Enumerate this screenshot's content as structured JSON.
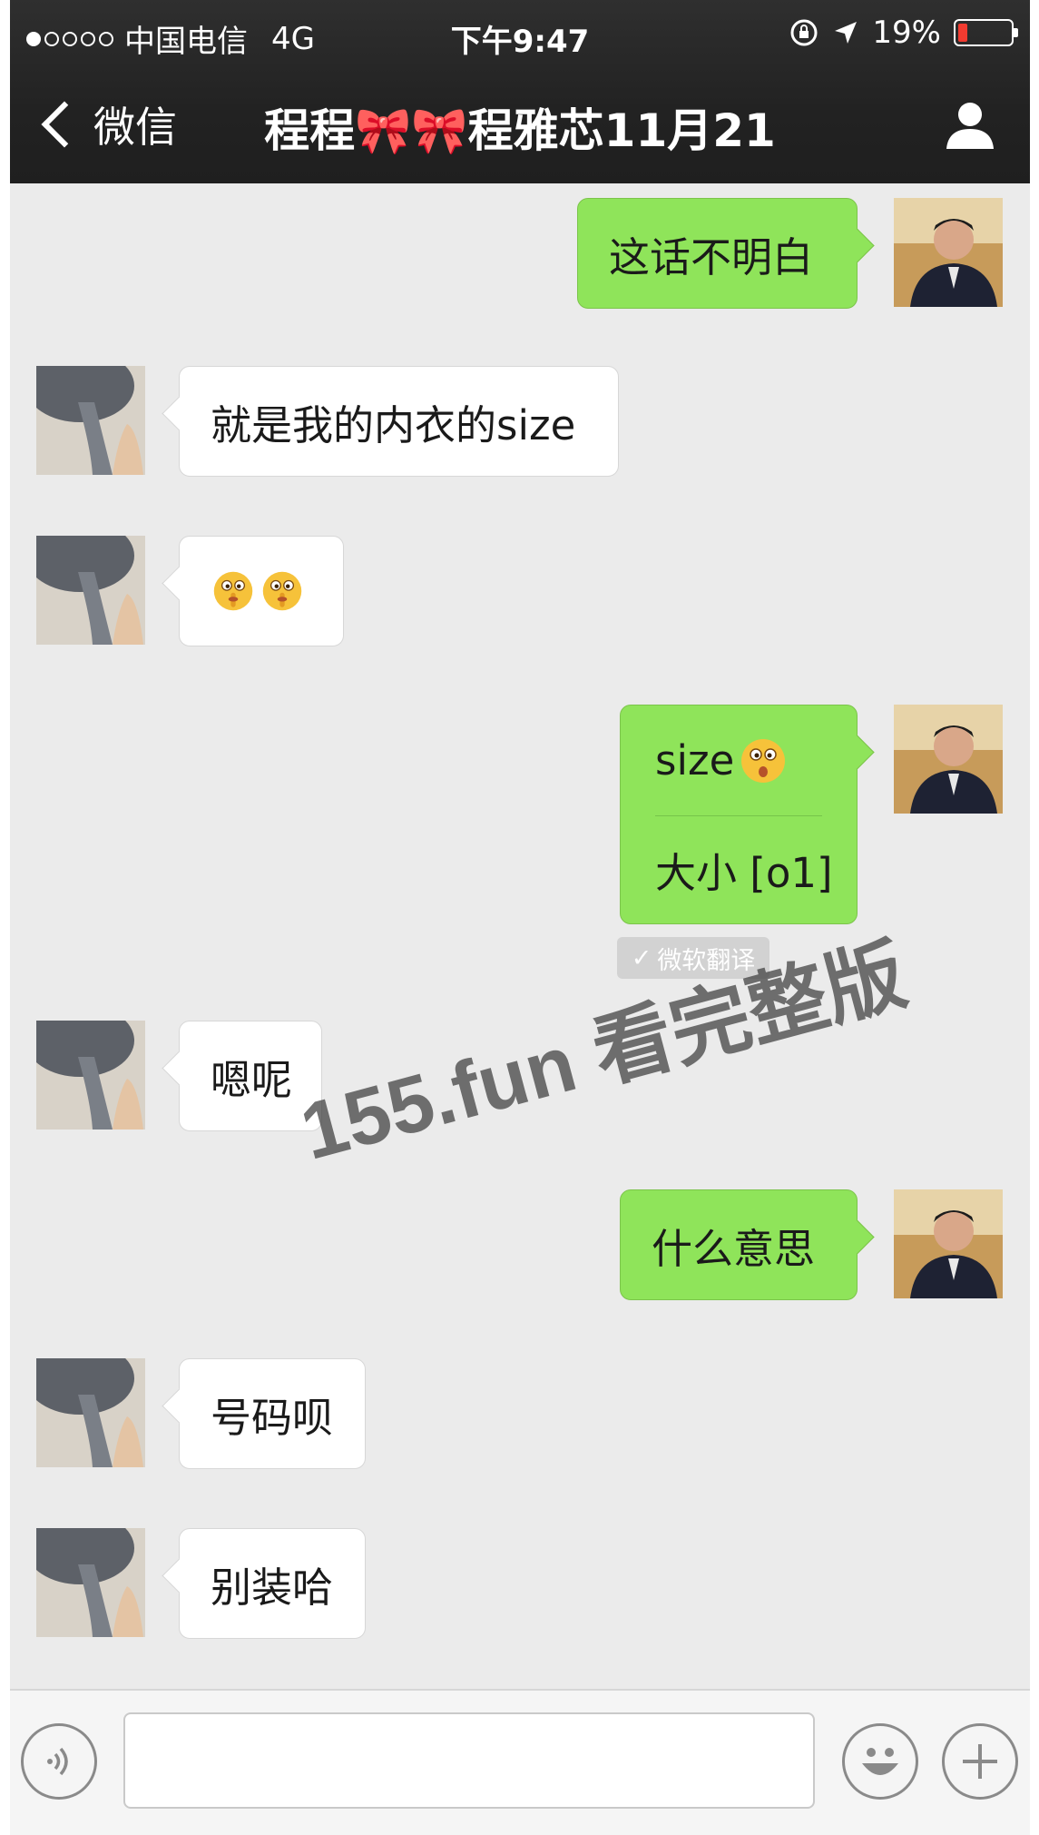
{
  "status_bar": {
    "carrier": "中国电信",
    "network": "4G",
    "time": "下午9:47",
    "battery": "19%",
    "battery_level": 0.19,
    "signal_bars": 1
  },
  "nav": {
    "back_label": "微信",
    "title_part1": "程程",
    "title_bow": "🎀🎀",
    "title_part2": "程雅芯11月21"
  },
  "messages": [
    {
      "side": "out",
      "text": "这话不明白"
    },
    {
      "side": "in",
      "text": "就是我的内衣的size"
    },
    {
      "side": "in",
      "emoji": [
        "shush-face-icon",
        "shush-face-icon"
      ]
    },
    {
      "side": "out",
      "text": "size",
      "trailing_emoji": "shush-face-icon",
      "translation": "大小 [o1]",
      "translation_badge": "微软翻译"
    },
    {
      "side": "in",
      "text": "嗯呢"
    },
    {
      "side": "out",
      "text": "什么意思"
    },
    {
      "side": "in",
      "text": "号码呗"
    },
    {
      "side": "in",
      "text": "别装哈"
    }
  ],
  "watermark": "155.fun 看完整版",
  "input_bar": {
    "text": "",
    "icons": [
      "voice-icon",
      "smiley-icon",
      "plus-icon"
    ]
  },
  "colors": {
    "nav_bg": "#262626",
    "chat_bg": "#ebebeb",
    "outgoing_bubble": "#8fe45a",
    "incoming_bubble": "#ffffff",
    "battery_low": "#f23b30",
    "bow": "#ff67b4"
  }
}
